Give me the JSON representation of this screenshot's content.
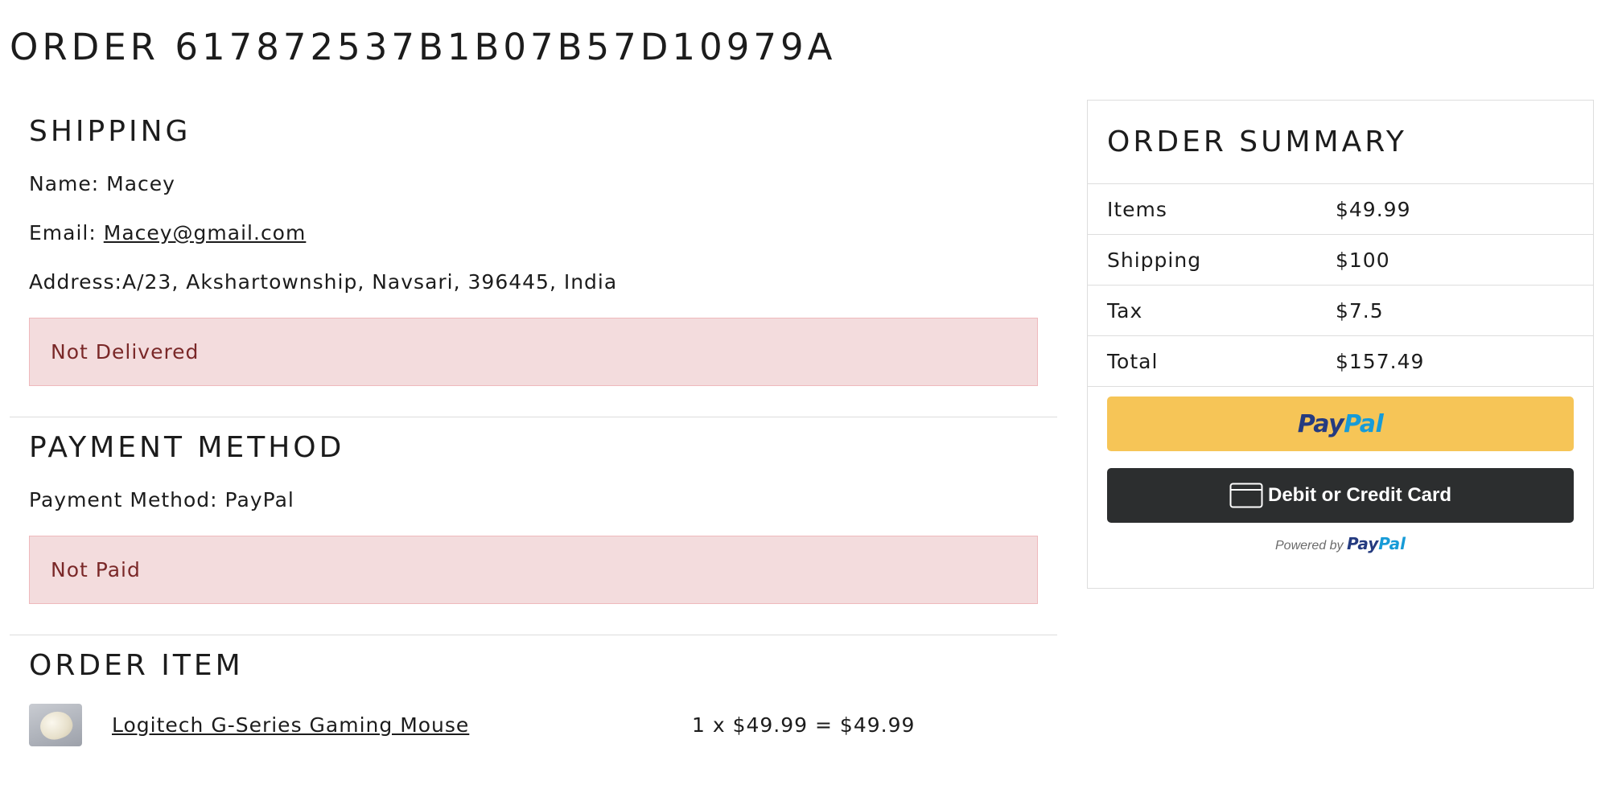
{
  "page": {
    "title": "ORDER 617872537B1B07B57D10979A"
  },
  "shipping": {
    "heading": "SHIPPING",
    "name_label": "Name:",
    "name": "Macey",
    "email_label": "Email:",
    "email": "Macey@gmail.com",
    "address_label": "Address:",
    "address": "A/23, Akshartownship, Navsari, 396445, India",
    "status": "Not Delivered"
  },
  "payment": {
    "heading": "PAYMENT METHOD",
    "method_label": "Payment Method:",
    "method": "PayPal",
    "status": "Not Paid"
  },
  "order_items": {
    "heading": "ORDER ITEM",
    "items": [
      {
        "name": "Logitech G-Series Gaming Mouse",
        "calc": "1 x $49.99 = $49.99",
        "icon": "product-image-mouse"
      }
    ]
  },
  "summary": {
    "heading": "ORDER SUMMARY",
    "rows": [
      {
        "label": "Items",
        "value": "$49.99"
      },
      {
        "label": "Shipping",
        "value": "$100"
      },
      {
        "label": "Tax",
        "value": "$7.5"
      },
      {
        "label": "Total",
        "value": "$157.49"
      }
    ],
    "paypal_button": {
      "part1": "Pay",
      "part2": "Pal"
    },
    "card_button": {
      "label": "Debit or Credit Card",
      "icon": "credit-card-icon"
    },
    "powered_by": {
      "prefix": "Powered by",
      "part1": "Pay",
      "part2": "Pal"
    }
  },
  "colors": {
    "alert_bg": "#f3dcdd",
    "alert_text": "#7a2828",
    "paypal_yellow": "#f6c557",
    "paypal_dark_blue": "#253b80",
    "paypal_light_blue": "#179bd7",
    "card_button_bg": "#2c2e2f"
  }
}
